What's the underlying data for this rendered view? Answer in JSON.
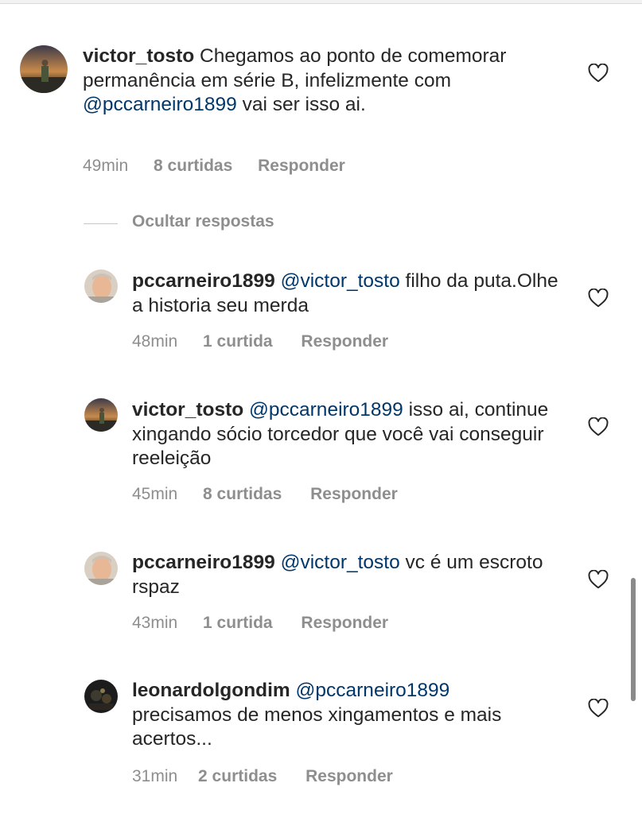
{
  "comments": [
    {
      "username": "victor_tosto",
      "text_before": "Chegamos ao ponto de comemorar permanência em série B, infelizmente com ",
      "mention": "@pccarneiro1899",
      "text_after": " vai ser isso ai.",
      "time": "49min",
      "likes": "8 curtidas",
      "reply": "Responder",
      "avatar": "sunset-landscape-avatar"
    }
  ],
  "hide_replies_label": "Ocultar respostas",
  "replies": [
    {
      "username": "pccarneiro1899",
      "mention": "@victor_tosto",
      "text": " filho da puta.Olhe a historia seu merda",
      "time": "48min",
      "likes": "1 curtida",
      "reply": "Responder",
      "avatar": "person-face-avatar"
    },
    {
      "username": "victor_tosto",
      "mention": "@pccarneiro1899",
      "text": " isso ai, continue xingando sócio torcedor que você vai conseguir reeleição",
      "time": "45min",
      "likes": "8 curtidas",
      "reply": "Responder",
      "avatar": "sunset-landscape-avatar"
    },
    {
      "username": "pccarneiro1899",
      "mention": "@victor_tosto",
      "text": " vc é um escroto rspaz",
      "time": "43min",
      "likes": "1 curtida",
      "reply": "Responder",
      "avatar": "person-face-avatar"
    },
    {
      "username": "leonardolgondim",
      "mention": "@pccarneiro1899",
      "text": " precisamos de menos xingamentos e mais acertos...",
      "time": "31min",
      "likes": "2 curtidas",
      "reply": "Responder",
      "avatar": "dark-photo-avatar"
    }
  ],
  "icons": {
    "like": "heart-outline-icon"
  },
  "colors": {
    "text": "#262626",
    "mention": "#00376b",
    "meta": "#8e8e8e",
    "background": "#ffffff"
  }
}
